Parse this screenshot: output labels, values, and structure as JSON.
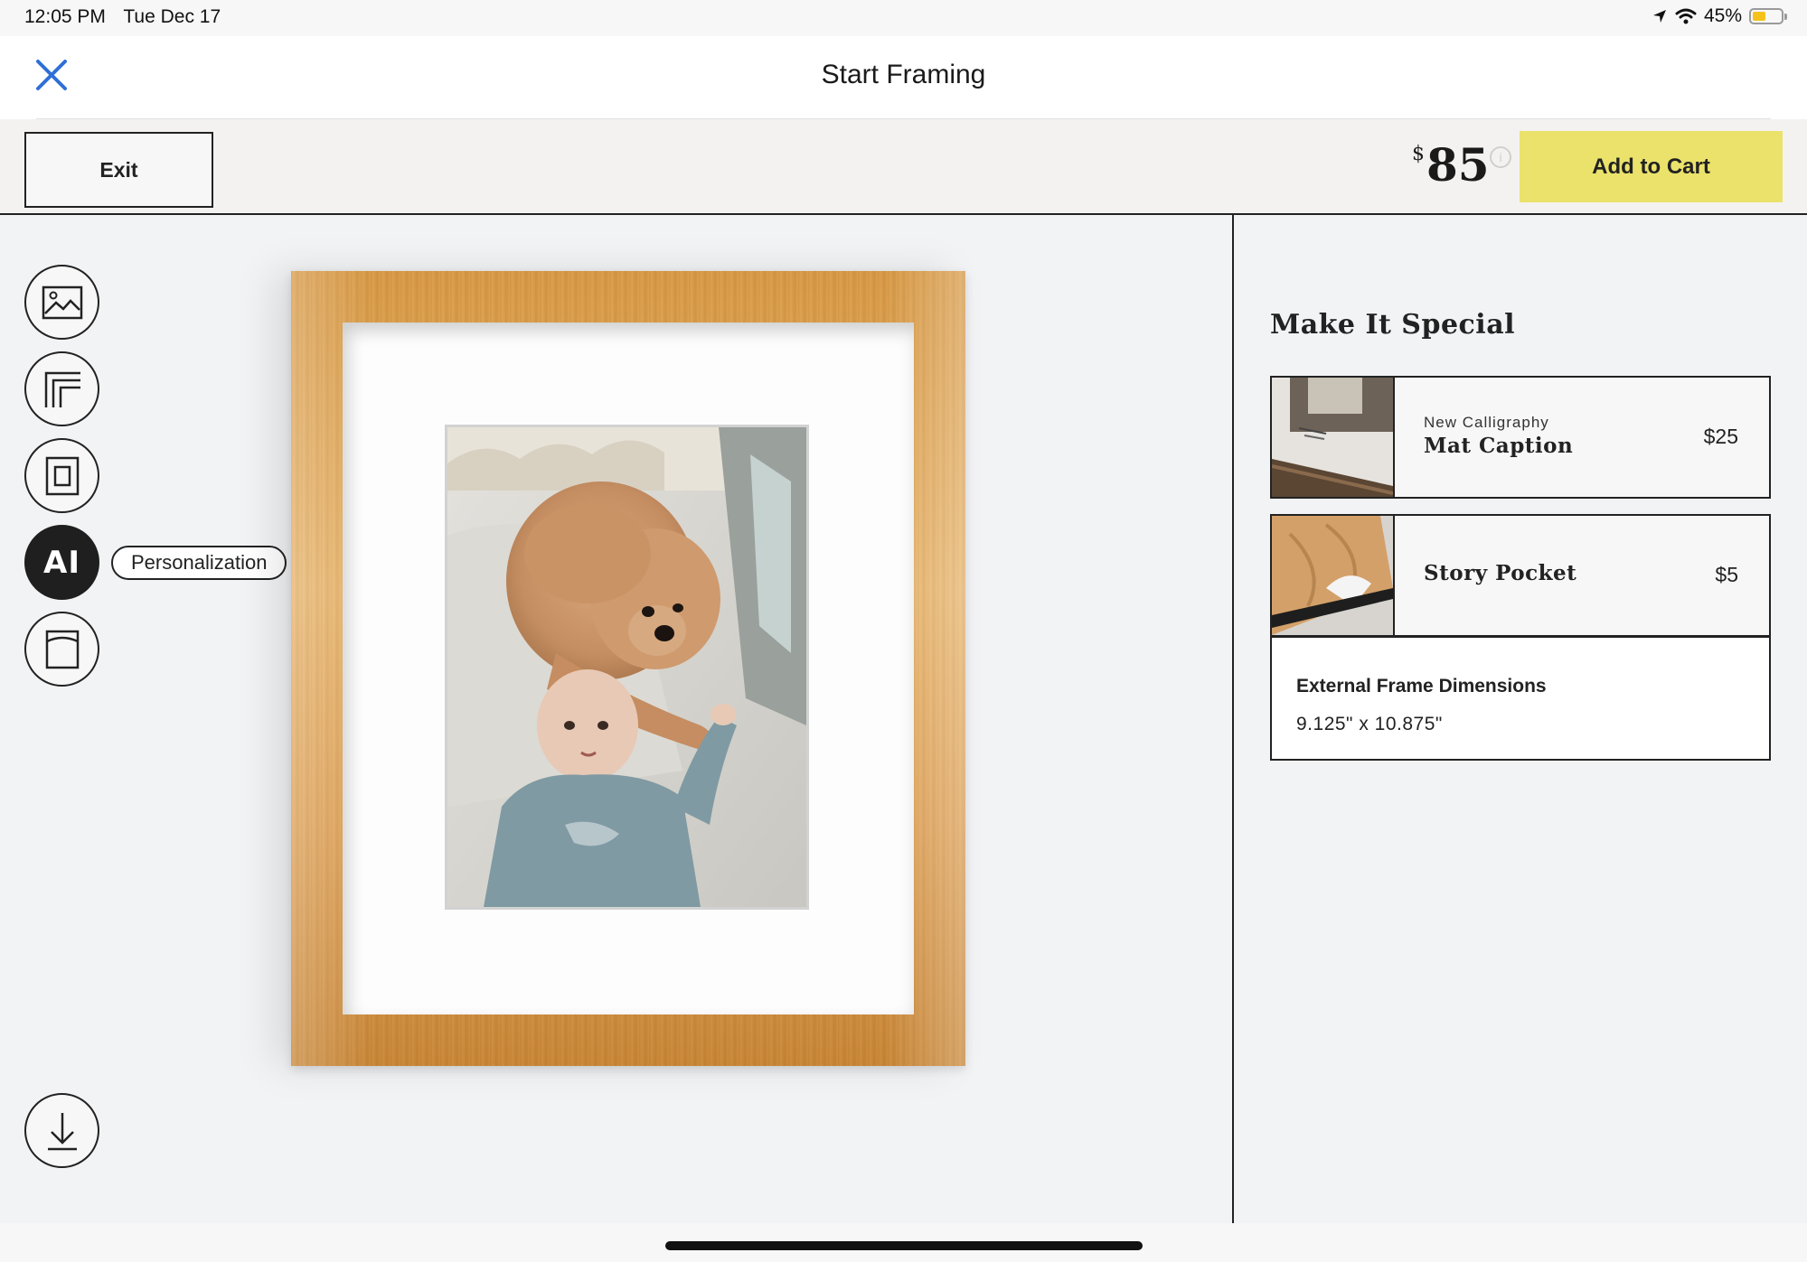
{
  "status_bar": {
    "time": "12:05 PM",
    "date": "Tue Dec 17",
    "battery": "45%",
    "battery_level": 0.45,
    "icons": [
      "location-arrow-icon",
      "wifi-icon",
      "battery-icon"
    ]
  },
  "header": {
    "title": "Start Framing",
    "close_icon": "close-icon"
  },
  "toolbar": {
    "exit_label": "Exit",
    "price_currency": "$",
    "price_value": "85",
    "info_icon": "info-icon",
    "add_to_cart_label": "Add to Cart"
  },
  "tools": {
    "items": [
      "photo-icon",
      "frame-style-icon",
      "mat-icon",
      "personalization-icon",
      "story-pocket-icon"
    ],
    "active_glyph": "AI",
    "tooltip": "Personalization",
    "download_icon": "download-icon"
  },
  "panel": {
    "title": "Make It Special",
    "options": [
      {
        "small": "New Calligraphy",
        "name": "Mat Caption",
        "price": "$25"
      },
      {
        "name": "Story Pocket",
        "price": "$5"
      }
    ],
    "dimensions_label": "External Frame Dimensions",
    "dimensions_value": "9.125\" x 10.875\""
  },
  "colors": {
    "accent_close": "#2f6fd6",
    "cart_button": "#ebe26b",
    "active_tool": "#1f1f1f"
  }
}
